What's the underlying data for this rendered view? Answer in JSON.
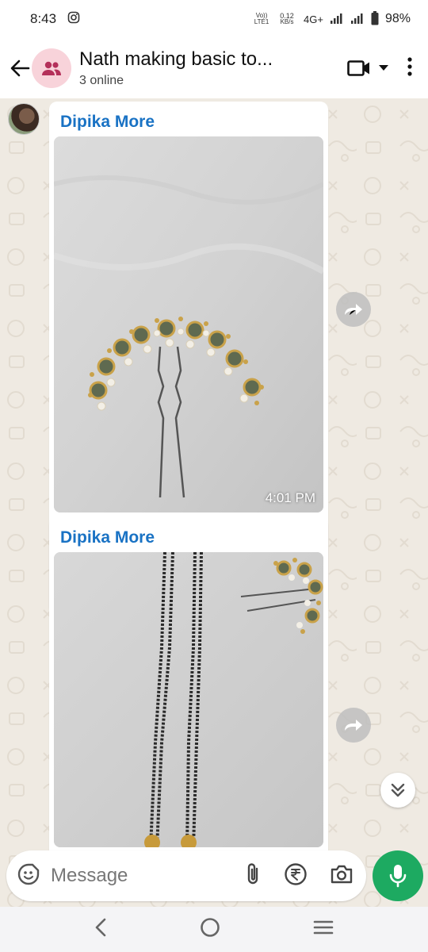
{
  "status_bar": {
    "time": "8:43",
    "volte": "Vo)) LTE1",
    "speed": "0.12",
    "speed_unit": "KB/s",
    "network": "4G+",
    "battery": "98%"
  },
  "header": {
    "title": "Nath making basic to...",
    "subtitle": "3 online"
  },
  "messages": [
    {
      "sender": "Dipika More",
      "time": "4:01 PM",
      "type": "image"
    },
    {
      "sender": "Dipika More",
      "time": "",
      "type": "image"
    }
  ],
  "composer": {
    "placeholder": "Message"
  },
  "colors": {
    "accent": "#1daa61",
    "sender_name": "#1972c4",
    "chat_bg": "#efeae2"
  },
  "icons": [
    "back-arrow-icon",
    "group-icon",
    "video-call-icon",
    "dropdown-icon",
    "more-options-icon",
    "forward-icon",
    "double-chevron-down-icon",
    "sticker-icon",
    "attach-icon",
    "rupee-payment-icon",
    "camera-icon",
    "microphone-icon",
    "nav-back-icon",
    "nav-home-icon",
    "nav-recents-icon",
    "instagram-icon"
  ]
}
